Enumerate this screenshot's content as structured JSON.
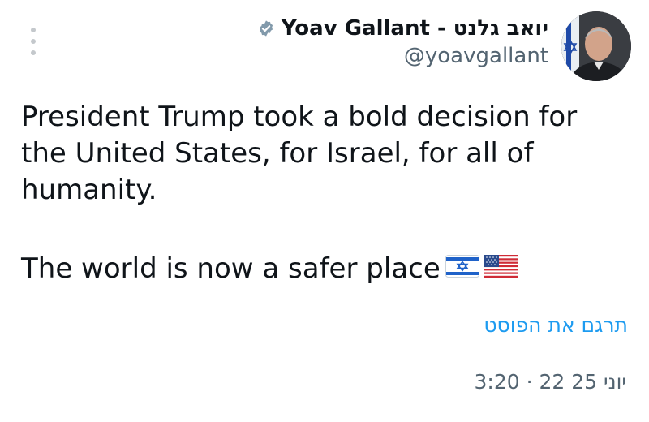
{
  "author": {
    "display_name": "Yoav Gallant - יואב גלנט",
    "handle": "@yoavgallant",
    "verified_icon": "verified-badge-icon",
    "verified_color": "#829aab",
    "avatar_icon": "profile-avatar"
  },
  "more_icon": "more-options-icon",
  "tweet": {
    "paragraph1": "President Trump took a bold decision for the United States, for Israel, for all of humanity.",
    "paragraph2": "The world is now a safer place",
    "emojis": [
      "israel-flag-icon",
      "usa-flag-icon"
    ]
  },
  "translate_label": "תרגם את הפוסט",
  "timestamp": "3:20 · 22 יוני 25",
  "colors": {
    "link": "#1d9bf0",
    "secondary_text": "#536471",
    "primary_text": "#0f1419"
  }
}
